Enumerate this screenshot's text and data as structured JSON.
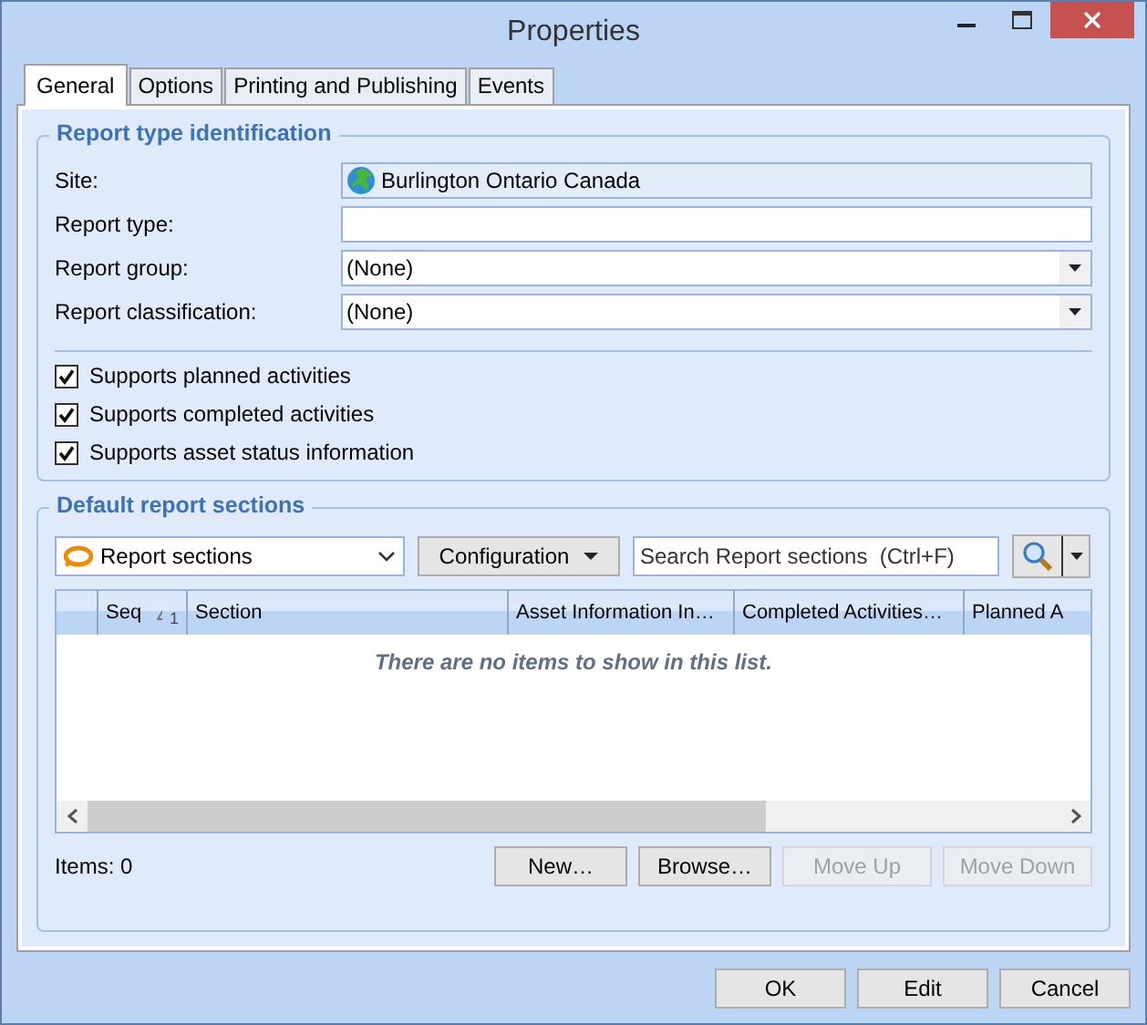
{
  "window": {
    "title": "Properties"
  },
  "tabs": [
    {
      "label": "General",
      "selected": true
    },
    {
      "label": "Options",
      "selected": false
    },
    {
      "label": "Printing and Publishing",
      "selected": false
    },
    {
      "label": "Events",
      "selected": false
    }
  ],
  "identification": {
    "title": "Report type identification",
    "fields": [
      {
        "label": "Site:",
        "kind": "site",
        "value": "Burlington Ontario Canada"
      },
      {
        "label": "Report type:",
        "kind": "text"
      },
      {
        "label": "Report group:",
        "kind": "combo",
        "value": "(None)"
      },
      {
        "label": "Report classification:",
        "kind": "combo",
        "value": "(None)"
      }
    ],
    "checkboxes": [
      {
        "label": "Supports planned activities",
        "checked": true
      },
      {
        "label": "Supports completed activities",
        "checked": true
      },
      {
        "label": "Supports asset status information",
        "checked": true
      }
    ]
  },
  "sections": {
    "title": "Default report sections",
    "view_selector": "Report sections",
    "configuration_button": "Configuration",
    "search": {
      "placeholder": "Search Report sections  (Ctrl+F)"
    },
    "table": {
      "columns": [
        {
          "label": "Seq",
          "sort_index": "1"
        },
        {
          "label": "Section"
        },
        {
          "label": "Asset Information In…"
        },
        {
          "label": "Completed Activities…"
        },
        {
          "label": "Planned A"
        }
      ],
      "empty_message": "There are no items to show in this list."
    },
    "items_count": "Items: 0",
    "buttons": [
      {
        "label": "New…",
        "disabled": false
      },
      {
        "label": "Browse…",
        "disabled": false
      },
      {
        "label": "Move Up",
        "disabled": true
      },
      {
        "label": "Move Down",
        "disabled": true
      }
    ]
  },
  "footer_buttons": [
    {
      "label": "OK"
    },
    {
      "label": "Edit"
    },
    {
      "label": "Cancel"
    }
  ]
}
